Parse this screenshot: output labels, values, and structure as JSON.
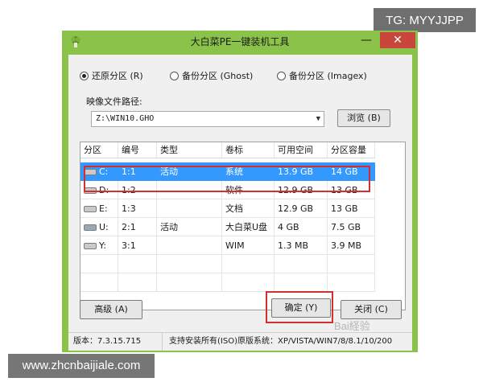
{
  "watermark_top": "TG: MYYJJPP",
  "watermark_bottom": "www.zhcnbaijiale.com",
  "watermark_baidu": "Bai経验",
  "window": {
    "title": "大白菜PE一键装机工具",
    "minimize": "—",
    "close": "✕"
  },
  "modes": [
    {
      "label": "还原分区 (R)",
      "selected": true
    },
    {
      "label": "备份分区 (Ghost)",
      "selected": false
    },
    {
      "label": "备份分区 (Imagex)",
      "selected": false
    }
  ],
  "image_path": {
    "label": "映像文件路径:",
    "value": "Z:\\WIN10.GHO",
    "browse_label": "浏览 (B)"
  },
  "table": {
    "headers": [
      "分区",
      "编号",
      "类型",
      "卷标",
      "可用空间",
      "分区容量"
    ],
    "rows": [
      {
        "drive": "C:",
        "num": "1:1",
        "type": "活动",
        "label": "系统",
        "free": "13.9 GB",
        "size": "14 GB",
        "icon": "hdd-icon"
      },
      {
        "drive": "D:",
        "num": "1:2",
        "type": "",
        "label": "软件",
        "free": "12.9 GB",
        "size": "13 GB",
        "icon": "hdd-icon"
      },
      {
        "drive": "E:",
        "num": "1:3",
        "type": "",
        "label": "文档",
        "free": "12.9 GB",
        "size": "13 GB",
        "icon": "hdd-icon"
      },
      {
        "drive": "U:",
        "num": "2:1",
        "type": "活动",
        "label": "大白菜U盘",
        "free": "4 GB",
        "size": "7.5 GB",
        "icon": "usb-icon"
      },
      {
        "drive": "Y:",
        "num": "3:1",
        "type": "",
        "label": "WIM",
        "free": "1.3 MB",
        "size": "3.9 MB",
        "icon": "hdd-icon"
      }
    ]
  },
  "buttons": {
    "advanced": "高级 (A)",
    "ok": "确定 (Y)",
    "close": "关闭 (C)"
  },
  "status": {
    "version": "版本：7.3.15.715",
    "support": "支持安装所有(ISO)原版系统：XP/VISTA/WIN7/8/8.1/10/200"
  },
  "colors": {
    "window_frame": "#8bc34a",
    "selection": "#3399ff",
    "highlight_box": "#d32f2f"
  }
}
